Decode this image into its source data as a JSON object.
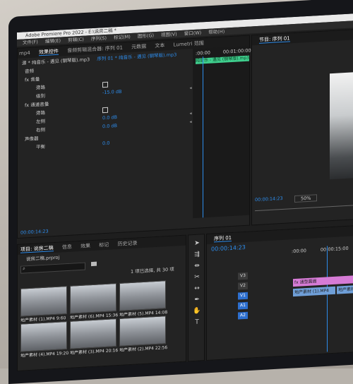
{
  "app": {
    "title": "Adobe Premiere Pro 2022 - E:\\说房二稿 *",
    "menu": [
      "文件(F)",
      "编辑(E)",
      "剪辑(C)",
      "序列(S)",
      "标记(M)",
      "图形(G)",
      "视图(V)",
      "窗口(W)",
      "帮助(H)"
    ],
    "left_tab_fragment": "mp4"
  },
  "effects_panel": {
    "tabs": [
      "效果控件",
      "音频剪辑混合器: 序列 01",
      "元数据",
      "文本",
      "Lumetri 范围"
    ],
    "source": "源 * 纯音乐 - 遇见 (钢琴版).mp3",
    "sequence": "序列 01 * 纯音乐 - 遇见 (钢琴版).mp3",
    "time_start": ":00:00",
    "time_end": "00:01:00:00",
    "clip_label": "纯音乐 - 遇见 (钢琴版).mp3",
    "sections": {
      "audio": "音频",
      "volume": "fx 音量",
      "bypass": "旁路",
      "level": "级别",
      "level_value": "-15.0 dB",
      "channel": "fx 通道音量",
      "bypass2": "旁路",
      "left": "左侧",
      "left_value": "0.0 dB",
      "right": "右侧",
      "right_value": "0.0 dB",
      "panner": "声像器",
      "balance": "平衡",
      "balance_value": "0.0"
    },
    "timecode": "00:00:14:23"
  },
  "program": {
    "title": "节目: 序列 01",
    "timecode": "00:00:14:23",
    "zoom": "50%"
  },
  "project": {
    "tabs": [
      "项目: 说房二稿",
      "信息",
      "效果",
      "标记",
      "历史记录"
    ],
    "file": "说房二稿.prproj",
    "selection": "1 项已选择, 共 30 项",
    "items": [
      {
        "name": "地产素材 (1).MP4",
        "dur": "9:60"
      },
      {
        "name": "地产素材 (6).MP4",
        "dur": "15:36"
      },
      {
        "name": "地产素材 (5).MP4",
        "dur": "14:08"
      },
      {
        "name": "地产素材 (4).MP4",
        "dur": "19:20"
      },
      {
        "name": "地产素材 (3).MP4",
        "dur": "20:16"
      },
      {
        "name": "地产素材 (2).MP4",
        "dur": "22:56"
      }
    ]
  },
  "timeline": {
    "title": "序列 01",
    "timecode": "00:00:14:23",
    "ruler_start": ":00:00",
    "ruler_mark": "00:00:15:00",
    "tracks": [
      {
        "name": "V3"
      },
      {
        "name": "V2"
      },
      {
        "name": "V1"
      },
      {
        "name": "A1"
      },
      {
        "name": "A2"
      }
    ],
    "clips": {
      "title_clip": "fx 通型圆眉",
      "video_clip": "地产素材 (1).MP4",
      "video_clip2": "地产素材"
    }
  }
}
